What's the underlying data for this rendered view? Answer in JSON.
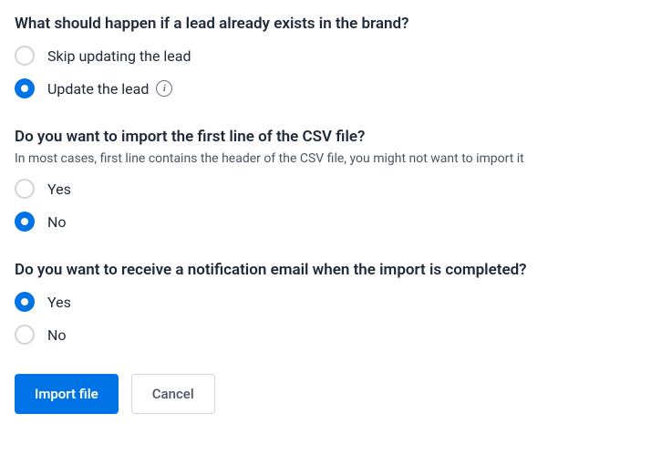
{
  "sections": {
    "existing_lead": {
      "title": "What should happen if a lead already exists in the brand?",
      "options": [
        {
          "label": "Skip updating the lead",
          "selected": false,
          "has_info": false
        },
        {
          "label": "Update the lead",
          "selected": true,
          "has_info": true
        }
      ]
    },
    "first_line": {
      "title": "Do you want to import the first line of the CSV file?",
      "subtitle": "In most cases, first line contains the header of the CSV file, you might not want to import it",
      "options": [
        {
          "label": "Yes",
          "selected": false
        },
        {
          "label": "No",
          "selected": true
        }
      ]
    },
    "notification": {
      "title": "Do you want to receive a notification email when the import is completed?",
      "options": [
        {
          "label": "Yes",
          "selected": true
        },
        {
          "label": "No",
          "selected": false
        }
      ]
    }
  },
  "buttons": {
    "import": "Import file",
    "cancel": "Cancel"
  },
  "info_glyph": "i"
}
